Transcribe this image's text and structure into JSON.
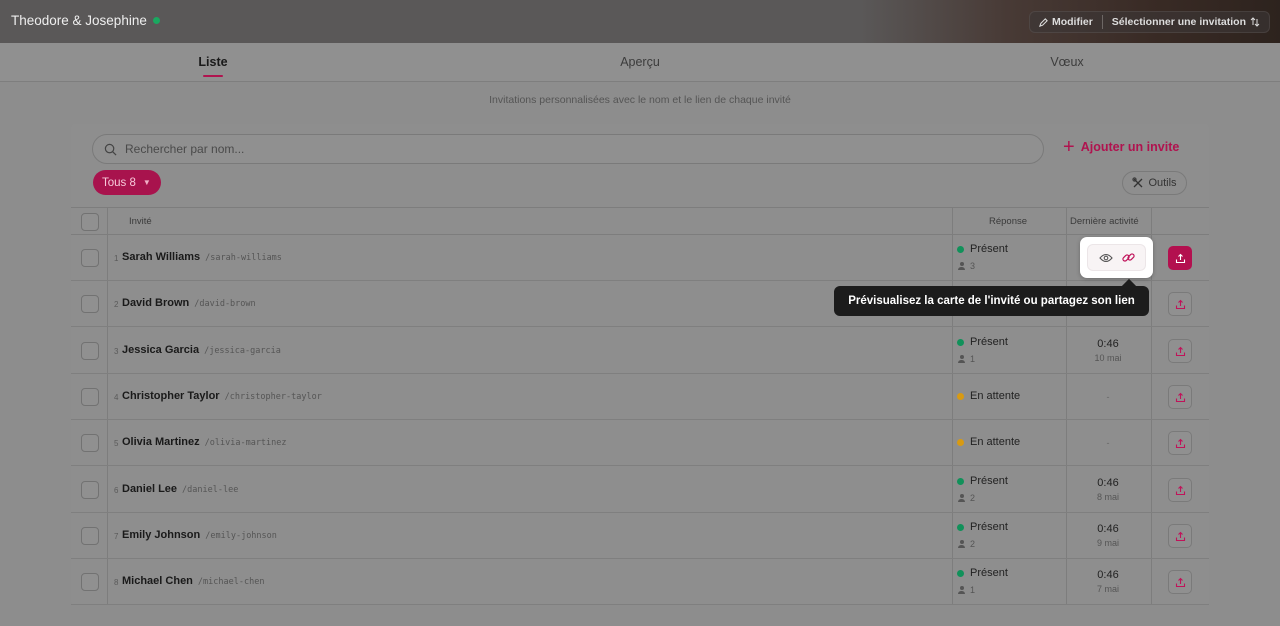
{
  "app": {
    "title": "Theodore & Josephine",
    "online_status_color": "#1aa860",
    "actions": {
      "edit": "Modifier",
      "select_invitation": "Sélectionner une invitation"
    }
  },
  "tabs": [
    {
      "label": "Liste",
      "active": true
    },
    {
      "label": "Aperçu",
      "active": false
    },
    {
      "label": "Vœux",
      "active": false
    }
  ],
  "subtitle": "Invitations personnalisées avec le nom et le lien de chaque invité",
  "toolbar": {
    "search_placeholder": "Rechercher par nom...",
    "add_label": "Ajouter un invite",
    "filter_label": "Tous 8",
    "tools_label": "Outils"
  },
  "table": {
    "headers": {
      "guest": "Invité",
      "response": "Réponse",
      "activity": "Dernière activité"
    },
    "rows": [
      {
        "num": "1",
        "name": "Sarah Williams",
        "slug": "/sarah-williams",
        "status": "Présent",
        "status_color": "green",
        "count": "3",
        "time": "",
        "date": "",
        "dash": ""
      },
      {
        "num": "2",
        "name": "David Brown",
        "slug": "/david-brown",
        "status": "",
        "status_color": "",
        "count": "",
        "time": "",
        "date": "",
        "dash": ""
      },
      {
        "num": "3",
        "name": "Jessica Garcia",
        "slug": "/jessica-garcia",
        "status": "Présent",
        "status_color": "green",
        "count": "1",
        "time": "0:46",
        "date": "10 mai",
        "dash": ""
      },
      {
        "num": "4",
        "name": "Christopher Taylor",
        "slug": "/christopher-taylor",
        "status": "En attente",
        "status_color": "amber",
        "count": "",
        "time": "",
        "date": "",
        "dash": "-"
      },
      {
        "num": "5",
        "name": "Olivia Martinez",
        "slug": "/olivia-martinez",
        "status": "En attente",
        "status_color": "amber",
        "count": "",
        "time": "",
        "date": "",
        "dash": "-"
      },
      {
        "num": "6",
        "name": "Daniel Lee",
        "slug": "/daniel-lee",
        "status": "Présent",
        "status_color": "green",
        "count": "2",
        "time": "0:46",
        "date": "8 mai",
        "dash": ""
      },
      {
        "num": "7",
        "name": "Emily Johnson",
        "slug": "/emily-johnson",
        "status": "Présent",
        "status_color": "green",
        "count": "2",
        "time": "0:46",
        "date": "9 mai",
        "dash": ""
      },
      {
        "num": "8",
        "name": "Michael Chen",
        "slug": "/michael-chen",
        "status": "Présent",
        "status_color": "green",
        "count": "1",
        "time": "0:46",
        "date": "7 mai",
        "dash": ""
      }
    ]
  },
  "tooltip": "Prévisualisez la carte de l'invité ou partagez son lien",
  "colors": {
    "accent": "#b0134f",
    "present": "#11915a",
    "pending": "#d89a12"
  }
}
